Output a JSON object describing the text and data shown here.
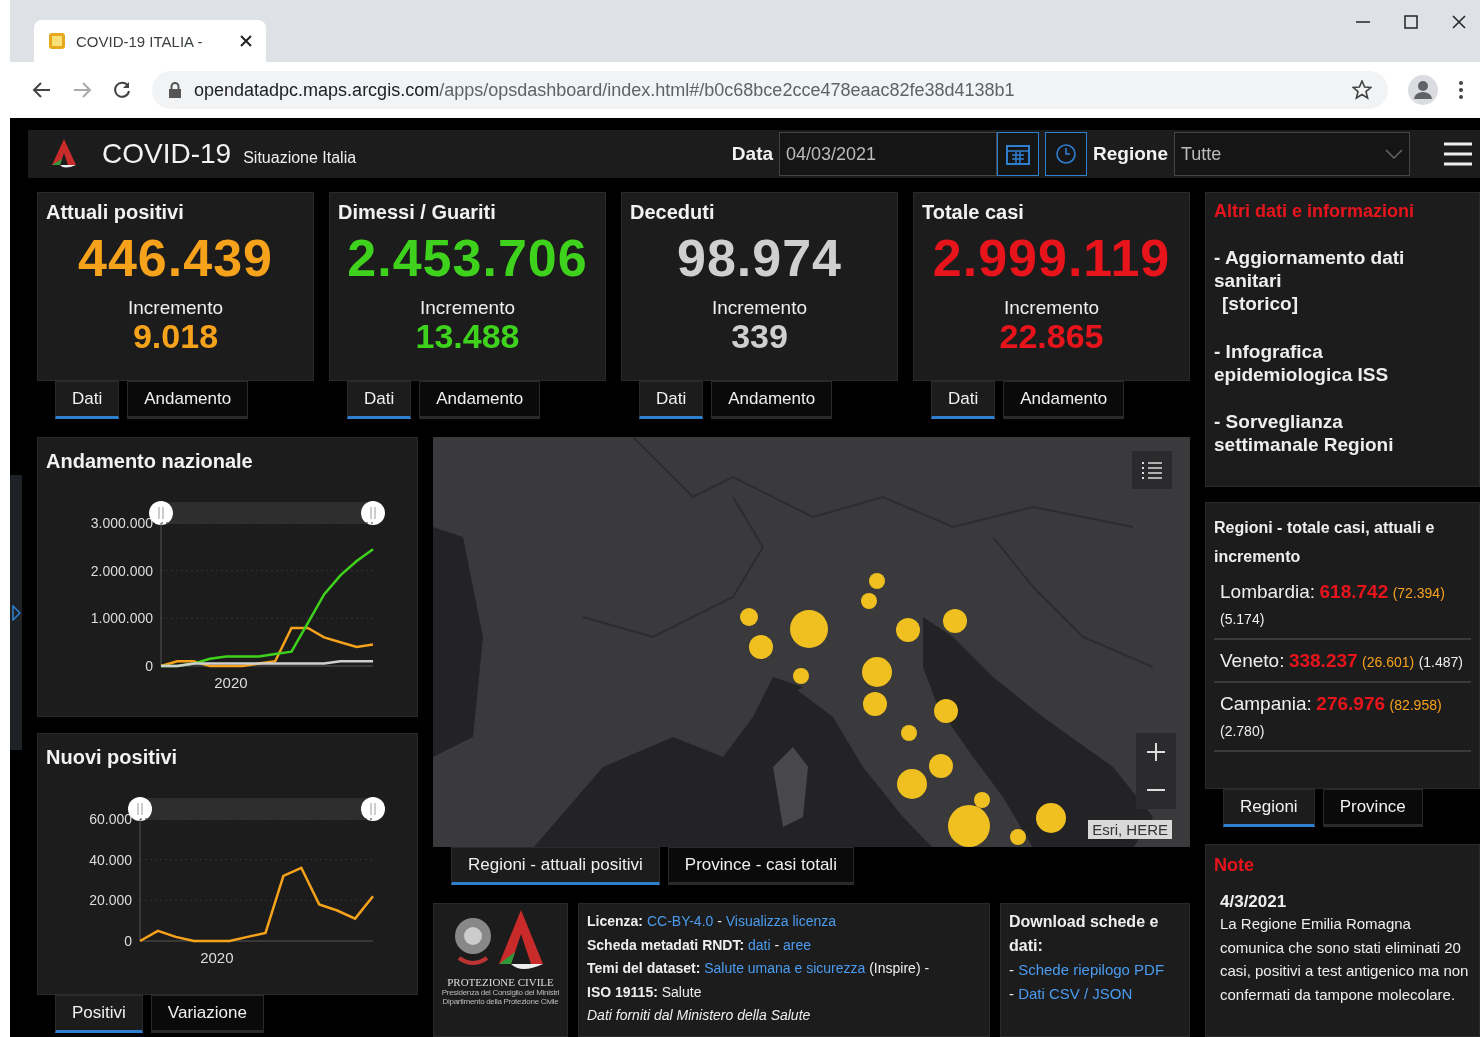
{
  "browser": {
    "tab_title": "COVID-19 ITALIA -",
    "url_host": "opendatadpc.maps.arcgis.com",
    "url_path": "/apps/opsdashboard/index.html#/b0c68bce2cce478eaac82fe38d4138b1"
  },
  "header": {
    "title": "COVID-19",
    "subtitle": "Situazione Italia",
    "date_label": "Data",
    "date_value": "04/03/2021",
    "region_label": "Regione",
    "region_value": "Tutte"
  },
  "kpis": [
    {
      "title": "Attuali positivi",
      "value": "446.439",
      "increment_label": "Incremento",
      "increment": "9.018",
      "color": "#f7a21b",
      "tabs": [
        {
          "label": "Dati",
          "selected": true
        },
        {
          "label": "Andamento",
          "selected": false
        }
      ]
    },
    {
      "title": "Dimessi / Guariti",
      "value": "2.453.706",
      "increment_label": "Incremento",
      "increment": "13.488",
      "color": "#3fd21c",
      "tabs": [
        {
          "label": "Dati",
          "selected": true
        },
        {
          "label": "Andamento",
          "selected": false
        }
      ]
    },
    {
      "title": "Deceduti",
      "value": "98.974",
      "increment_label": "Incremento",
      "increment": "339",
      "color": "#cfcfcf",
      "tabs": [
        {
          "label": "Dati",
          "selected": true
        },
        {
          "label": "Andamento",
          "selected": false
        }
      ]
    },
    {
      "title": "Totale casi",
      "value": "2.999.119",
      "increment_label": "Incremento",
      "increment": "22.865",
      "color": "#e8141c",
      "tabs": [
        {
          "label": "Dati",
          "selected": true
        },
        {
          "label": "Andamento",
          "selected": false
        }
      ]
    }
  ],
  "charts": [
    {
      "title": "Andamento nazionale",
      "chart_data": {
        "type": "line",
        "xlabel": "2020",
        "ylim": [
          0,
          3000000
        ],
        "yticks": [
          {
            "value": 0,
            "label": "0"
          },
          {
            "value": 1000000,
            "label": "1.000.000"
          },
          {
            "value": 2000000,
            "label": "2.000.000"
          },
          {
            "value": 3000000,
            "label": "3.000.000"
          }
        ],
        "series": [
          {
            "color": "#f7a21b",
            "values": [
              0,
              100000,
              100000,
              0,
              0,
              0,
              50000,
              100000,
              800000,
              800000,
              600000,
              500000,
              400000,
              450000
            ]
          },
          {
            "color": "#3fd21c",
            "values": [
              0,
              0,
              50000,
              150000,
              200000,
              200000,
              200000,
              250000,
              300000,
              900000,
              1500000,
              1900000,
              2200000,
              2450000
            ]
          },
          {
            "color": "#cfcfcf",
            "values": [
              0,
              0,
              50000,
              50000,
              50000,
              50000,
              50000,
              50000,
              50000,
              50000,
              50000,
              100000,
              100000,
              100000
            ]
          }
        ]
      }
    },
    {
      "title": "Nuovi positivi",
      "chart_data": {
        "type": "line",
        "xlabel": "2020",
        "ylim": [
          0,
          60000
        ],
        "yticks": [
          {
            "value": 0,
            "label": "0"
          },
          {
            "value": 20000,
            "label": "20.000"
          },
          {
            "value": 40000,
            "label": "40.000"
          },
          {
            "value": 60000,
            "label": "60.000"
          }
        ],
        "series": [
          {
            "color": "#f7a21b",
            "values": [
              0,
              5000,
              2000,
              0,
              0,
              0,
              2000,
              4000,
              32000,
              36000,
              18000,
              15000,
              11000,
              22000
            ]
          }
        ]
      }
    }
  ],
  "chart_tabs": [
    {
      "label": "Positivi",
      "selected": true
    },
    {
      "label": "Variazione",
      "selected": false
    }
  ],
  "map": {
    "attribution": "Esri, HERE",
    "tabs": [
      {
        "label": "Regioni - attuali positivi",
        "selected": true
      },
      {
        "label": "Province - casi totali",
        "selected": false
      }
    ]
  },
  "footer": {
    "logo_title": "PROTEZIONE CIVILE",
    "logo_lines": [
      "Presidenza del Consiglio dei Ministri",
      "Dipartimento della Protezione Civile"
    ],
    "lines": [
      [
        {
          "kind": "label",
          "text": "Licenza:"
        },
        {
          "kind": "link",
          "text": "CC-BY-4.0"
        },
        {
          "kind": "text",
          "text": "-"
        },
        {
          "kind": "link",
          "text": "Visualizza licenza"
        }
      ],
      [
        {
          "kind": "label",
          "text": "Scheda metadati RNDT:"
        },
        {
          "kind": "link",
          "text": "dati"
        },
        {
          "kind": "text",
          "text": "-"
        },
        {
          "kind": "link",
          "text": "aree"
        }
      ],
      [
        {
          "kind": "label",
          "text": "Temi del dataset:"
        },
        {
          "kind": "link",
          "text": "Salute umana e sicurezza"
        },
        {
          "kind": "text",
          "text": "(Inspire) -"
        }
      ],
      [
        {
          "kind": "label",
          "text": "ISO 19115:"
        },
        {
          "kind": "text",
          "text": "Salute"
        }
      ],
      [
        {
          "kind": "italic",
          "text": "Dati forniti dal Ministero della Salute"
        }
      ]
    ],
    "download_title": "Download schede e dati:",
    "downloads": [
      {
        "prefix": "-",
        "text": "Schede riepilogo PDF"
      },
      {
        "prefix": "-",
        "text": "Dati CSV / JSON"
      }
    ]
  },
  "info": {
    "title": "Altri dati e informazioni",
    "items": [
      {
        "text": "- Aggiornamento dati sanitari",
        "sub": "[storico]"
      },
      {
        "text": "- Infografica epidemiologica ISS"
      },
      {
        "text": "- Sorveglianza settimanale Regioni"
      }
    ]
  },
  "regions": {
    "title": "Regioni - totale casi, attuali e incremento",
    "rows": [
      {
        "name": "Lombardia:",
        "total": "618.742",
        "current": "(72.394)",
        "increment": "(5.174)"
      },
      {
        "name": "Veneto:",
        "total": "338.237",
        "current": "(26.601)",
        "increment": "(1.487)"
      },
      {
        "name": "Campania:",
        "total": "276.976",
        "current": "(82.958)",
        "increment": "(2.780)"
      }
    ],
    "tabs": [
      {
        "label": "Regioni",
        "selected": true
      },
      {
        "label": "Province",
        "selected": false
      }
    ]
  },
  "note": {
    "title": "Note",
    "date": "4/3/2021",
    "text": "La Regione Emilia Romagna comunica che sono stati eliminati 20 casi, positivi a test antigenico ma non confermati da tampone molecolare."
  }
}
